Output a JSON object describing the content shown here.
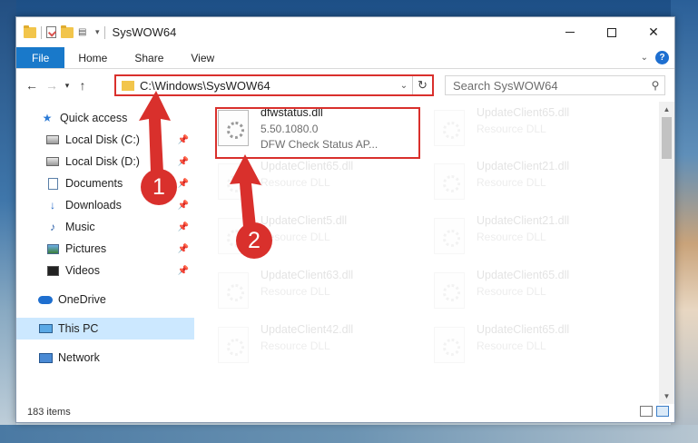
{
  "window": {
    "title": "SysWOW64",
    "controls": {
      "minimize": "",
      "maximize": "",
      "close": "✕"
    }
  },
  "ribbon": {
    "tabs": [
      "File",
      "Home",
      "Share",
      "View"
    ],
    "help": "?"
  },
  "address": {
    "path": "C:\\Windows\\SysWOW64",
    "search_placeholder": "Search SysWOW64"
  },
  "sidebar": {
    "items": [
      {
        "label": "Quick access",
        "icon": "star-icon",
        "pinned": false
      },
      {
        "label": "Local Disk (C:)",
        "icon": "disk-icon",
        "pinned": true
      },
      {
        "label": "Local Disk (D:)",
        "icon": "disk-icon",
        "pinned": true
      },
      {
        "label": "Documents",
        "icon": "documents-icon",
        "pinned": true
      },
      {
        "label": "Downloads",
        "icon": "download-icon",
        "pinned": true
      },
      {
        "label": "Music",
        "icon": "music-icon",
        "pinned": true
      },
      {
        "label": "Pictures",
        "icon": "pictures-icon",
        "pinned": true
      },
      {
        "label": "Videos",
        "icon": "videos-icon",
        "pinned": true
      },
      {
        "label": "OneDrive",
        "icon": "cloud-icon",
        "pinned": false
      },
      {
        "label": "This PC",
        "icon": "computer-icon",
        "pinned": false,
        "selected": true
      },
      {
        "label": "Network",
        "icon": "network-icon",
        "pinned": false
      }
    ]
  },
  "files": [
    {
      "name": "dfwstatus.dll",
      "version": "5.50.1080.0",
      "description": "DFW Check Status AP...",
      "highlighted": true
    },
    {
      "name": "UpdateClient65.dll",
      "description": "Resource DLL"
    },
    {
      "name": "UpdateClient65.dll",
      "description": "Resource DLL"
    },
    {
      "name": "UpdateClient21.dll",
      "description": "Resource DLL"
    },
    {
      "name": "UpdateClient5.dll",
      "description": "Resource DLL"
    },
    {
      "name": "UpdateClient21.dll",
      "description": "Resource DLL"
    },
    {
      "name": "UpdateClient63.dll",
      "description": "Resource DLL"
    },
    {
      "name": "UpdateClient65.dll",
      "description": "Resource DLL"
    },
    {
      "name": "UpdateClient42.dll",
      "description": "Resource DLL"
    },
    {
      "name": "UpdateClient65.dll",
      "description": "Resource DLL"
    }
  ],
  "status": {
    "item_count": "183 items"
  },
  "annotations": [
    "1",
    "2"
  ],
  "colors": {
    "accent": "#1979ca",
    "highlight": "#d9302c",
    "selected": "#cce8ff"
  }
}
